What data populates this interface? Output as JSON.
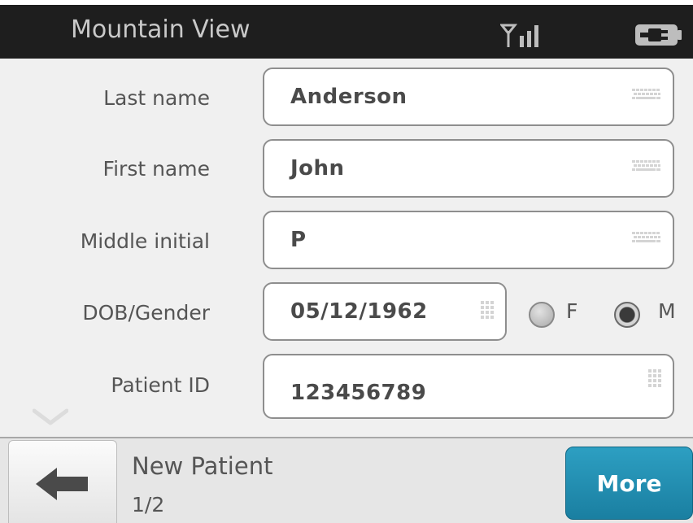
{
  "status": {
    "title": "Mountain View",
    "icons": [
      "signal-strength-icon",
      "battery-plug-icon"
    ]
  },
  "form": {
    "last_name": {
      "label": "Last name",
      "value": "Anderson",
      "input_icon": "keyboard-icon"
    },
    "first_name": {
      "label": "First name",
      "value": "John",
      "input_icon": "keyboard-icon"
    },
    "middle_initial": {
      "label": "Middle initial",
      "value": "P",
      "input_icon": "keyboard-icon"
    },
    "dob_gender": {
      "label": "DOB/Gender",
      "dob": "05/12/1962",
      "input_icon": "numpad-icon",
      "gender_options": [
        "F",
        "M"
      ],
      "gender_selected": "M"
    },
    "patient_id": {
      "label": "Patient ID",
      "value": "123456789",
      "input_icon": "numpad-icon"
    }
  },
  "footer": {
    "back_icon": "back-arrow-icon",
    "screen_title": "New Patient",
    "page_indicator": "1/2",
    "more_label": "More"
  },
  "colors": {
    "status_bar": "#1e1e1e",
    "background": "#f0f0f0",
    "accent_button": "#2390b4"
  }
}
